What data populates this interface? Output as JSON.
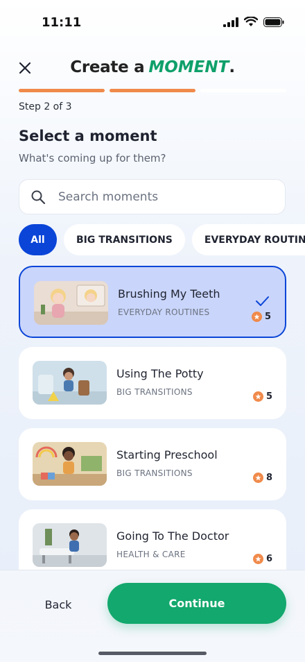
{
  "status": {
    "time": "11:11"
  },
  "header": {
    "title_prefix": "Create a",
    "title_brand": "MOMENT",
    "title_suffix": "."
  },
  "progress": {
    "current_step": 2,
    "total_steps": 3
  },
  "step_label": "Step 2 of 3",
  "heading": "Select a moment",
  "subheading": "What's coming up for them?",
  "search": {
    "placeholder": "Search moments",
    "value": ""
  },
  "filters": [
    {
      "label": "All",
      "active": true
    },
    {
      "label": "BIG TRANSITIONS",
      "active": false
    },
    {
      "label": "EVERYDAY ROUTINES",
      "active": false
    }
  ],
  "moments": [
    {
      "title": "Brushing My Teeth",
      "category": "EVERYDAY ROUTINES",
      "points": "5",
      "selected": true
    },
    {
      "title": "Using The Potty",
      "category": "BIG TRANSITIONS",
      "points": "5",
      "selected": false
    },
    {
      "title": "Starting Preschool",
      "category": "BIG TRANSITIONS",
      "points": "8",
      "selected": false
    },
    {
      "title": "Going To The Doctor",
      "category": "HEALTH & CARE",
      "points": "6",
      "selected": false
    }
  ],
  "footer": {
    "back_label": "Back",
    "continue_label": "Continue"
  },
  "colors": {
    "accent": "#0a45d8",
    "brand_green": "#13a86d",
    "progress_orange": "#f08a4b",
    "selected_card": "#c9d5fa"
  },
  "icons": {
    "close": "close-icon",
    "search": "search-icon",
    "check": "check-icon",
    "star": "star-icon"
  }
}
